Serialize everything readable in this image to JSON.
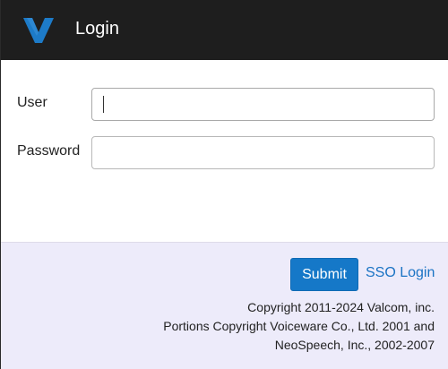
{
  "header": {
    "title": "Login",
    "logo_icon": "valcom-v-logo",
    "logo_color": "#1d7bc8"
  },
  "form": {
    "user_label": "User",
    "user_value": "",
    "password_label": "Password",
    "password_value": ""
  },
  "actions": {
    "submit_label": "Submit",
    "sso_label": "SSO Login"
  },
  "footer": {
    "copyright_line1": "Copyright 2011-2024 Valcom, inc.",
    "copyright_line2": "Portions Copyright Voiceware Co., Ltd. 2001 and",
    "copyright_line3": "NeoSpeech, Inc., 2002-2007"
  },
  "colors": {
    "header_bg": "#1e1e1e",
    "footer_bg": "#edebfa",
    "accent": "#1578c8"
  }
}
